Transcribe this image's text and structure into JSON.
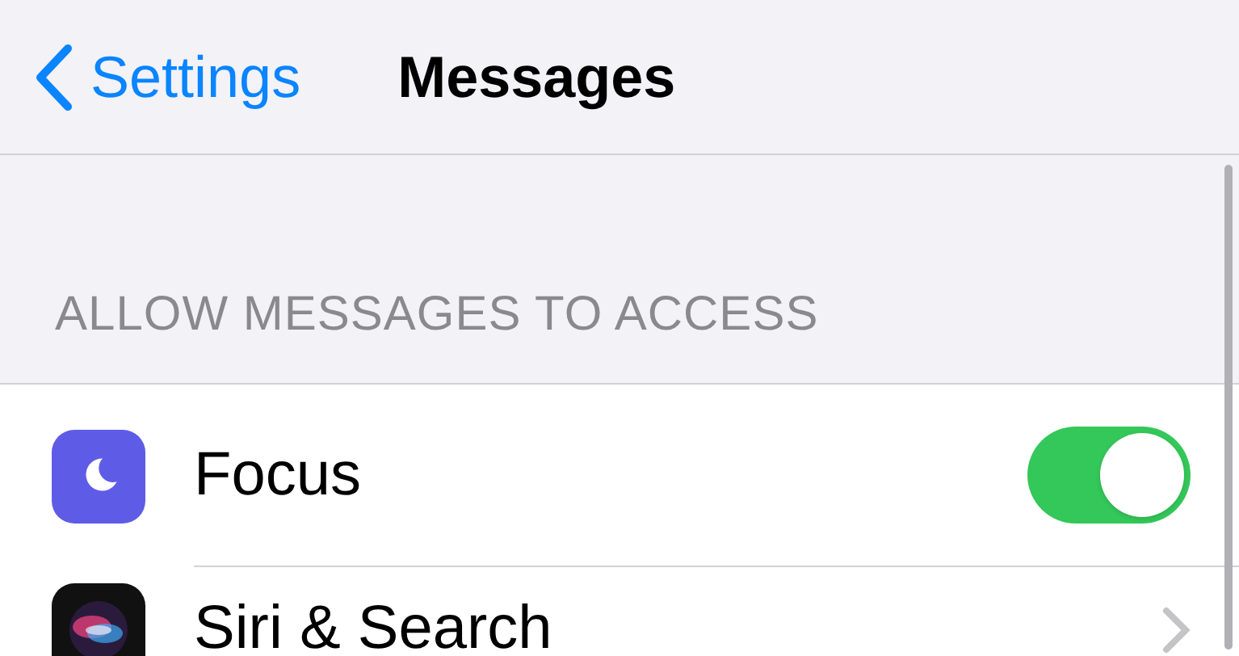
{
  "nav": {
    "back_label": "Settings",
    "title": "Messages"
  },
  "section": {
    "header": "ALLOW MESSAGES TO ACCESS",
    "rows": [
      {
        "kind": "toggle",
        "label": "Focus",
        "on": true
      },
      {
        "kind": "link",
        "label": "Siri & Search"
      }
    ]
  }
}
